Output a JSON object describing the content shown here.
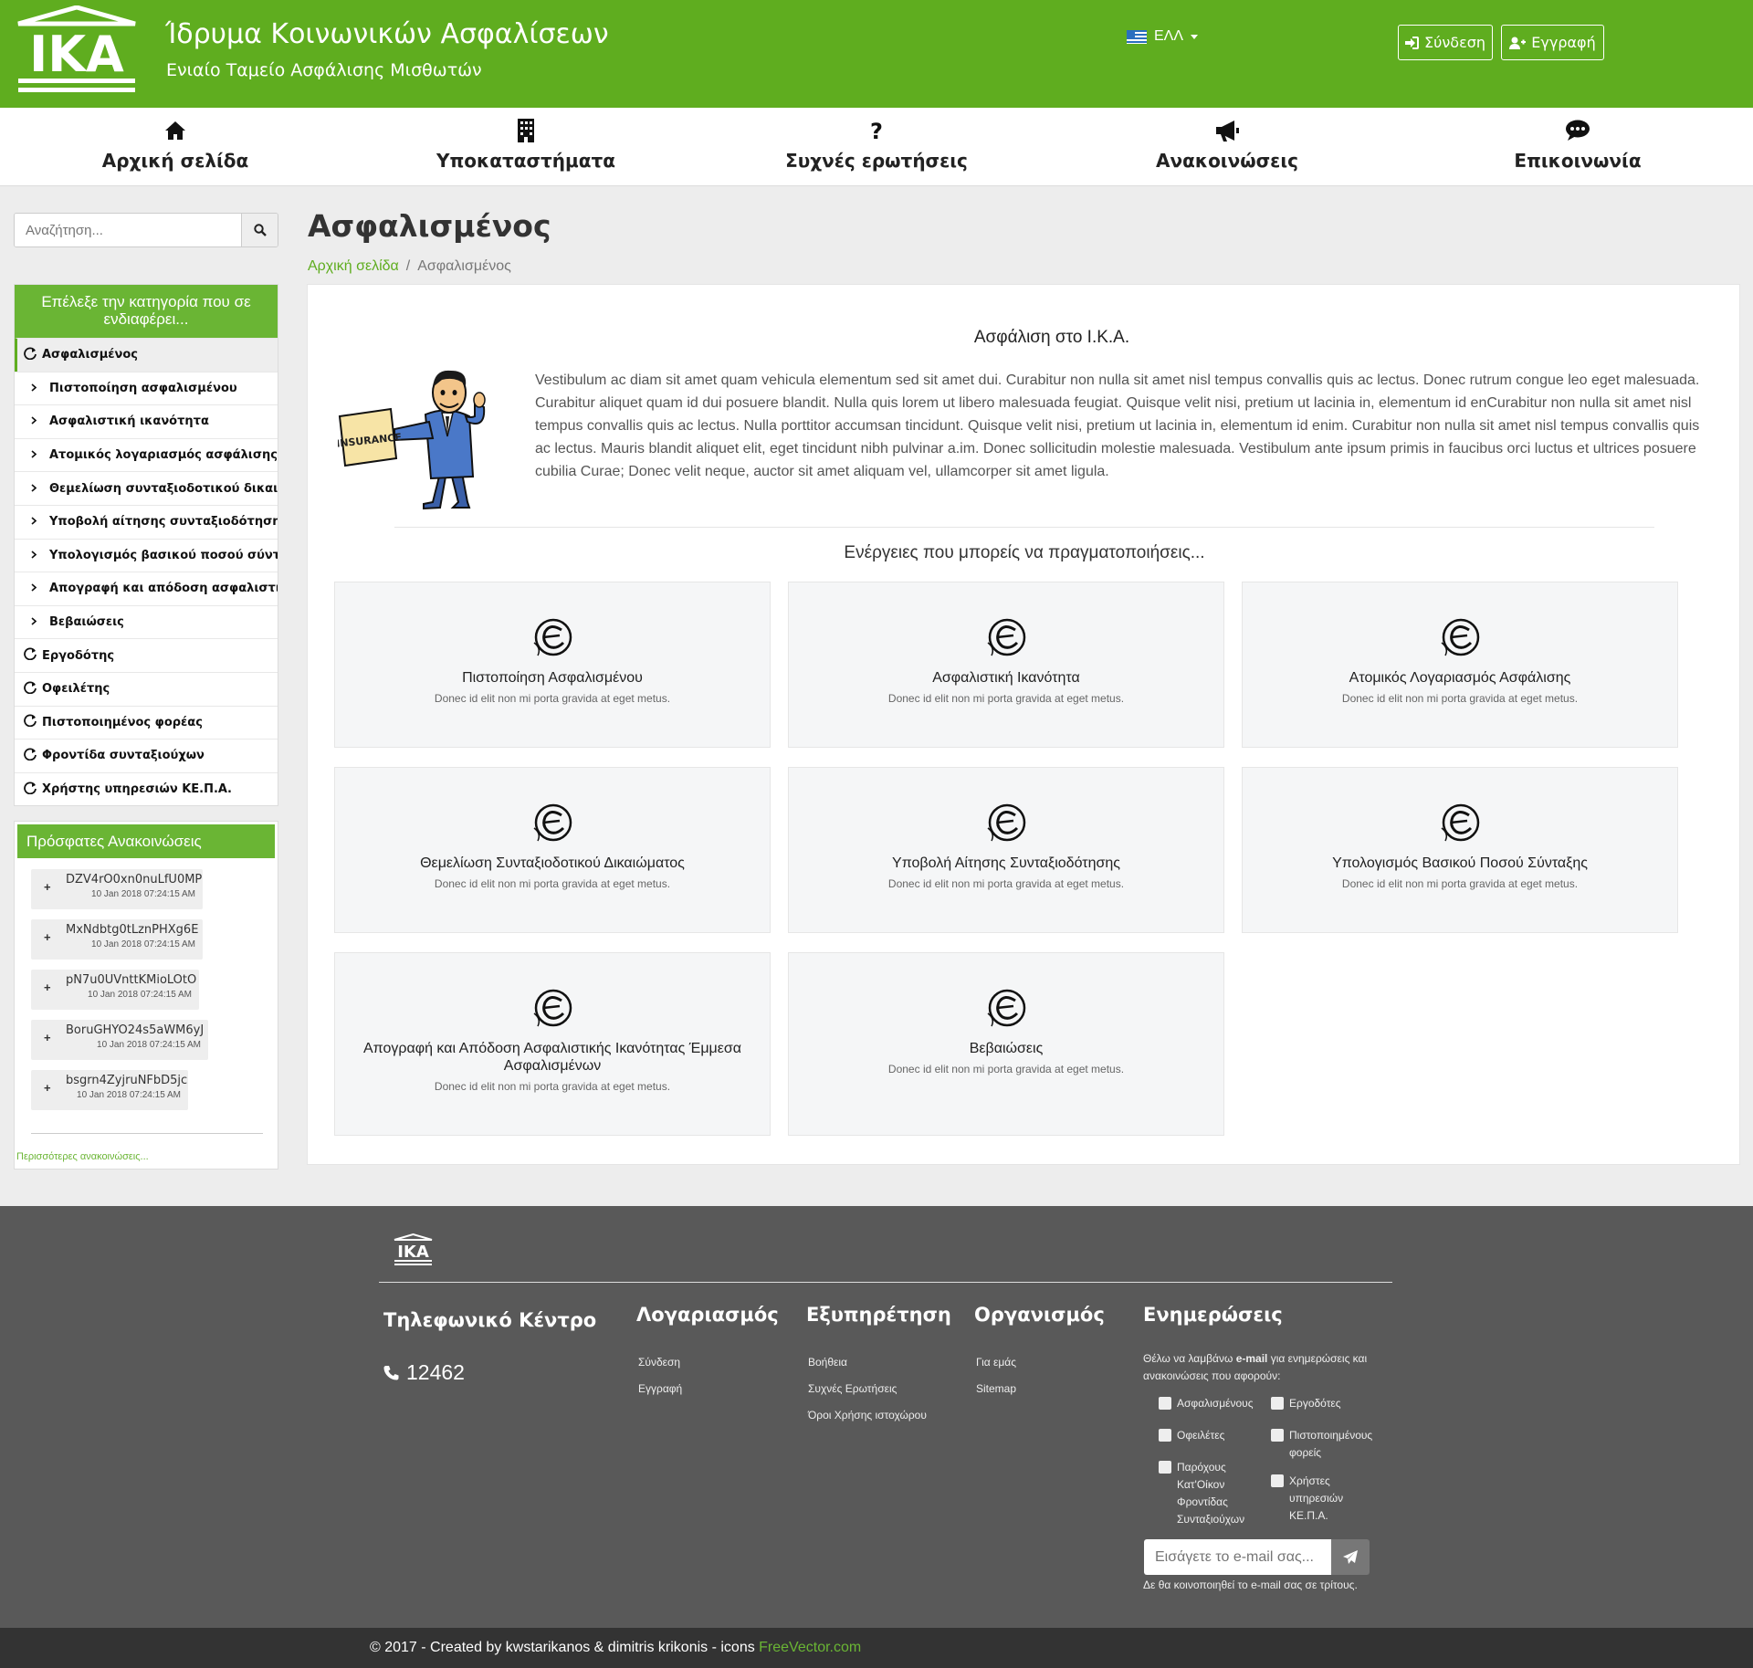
{
  "header": {
    "title": "Ίδρυμα Κοινωνικών Ασφαλίσεων",
    "subtitle": "Ενιαίο Ταμείο Ασφάλισης Μισθωτών",
    "logo_text": "IKA",
    "language": "ΕΛΛ",
    "login_label": "Σύνδεση",
    "register_label": "Εγγραφή"
  },
  "nav": [
    {
      "label": "Αρχική σελίδα",
      "icon": "home-icon"
    },
    {
      "label": "Υποκαταστήματα",
      "icon": "building-icon"
    },
    {
      "label": "Συχνές ερωτήσεις",
      "icon": "question-icon"
    },
    {
      "label": "Ανακοινώσεις",
      "icon": "bullhorn-icon"
    },
    {
      "label": "Επικοινωνία",
      "icon": "comment-icon"
    }
  ],
  "search": {
    "placeholder": "Αναζήτηση..."
  },
  "categories": {
    "heading": "Επέλεξε την κατηγορία που σε ενδιαφέρει...",
    "items": [
      {
        "label": "Ασφαλισμένος",
        "level": "top",
        "active": true
      },
      {
        "label": "Πιστοποίηση ασφαλισμένου",
        "level": "sub"
      },
      {
        "label": "Ασφαλιστική ικανότητα",
        "level": "sub"
      },
      {
        "label": "Ατομικός λογαριασμός ασφάλισης",
        "level": "sub"
      },
      {
        "label": "Θεμελίωση συνταξιοδοτικού δικαιώ...",
        "level": "sub"
      },
      {
        "label": "Υποβολή αίτησης συνταξιοδότησης",
        "level": "sub"
      },
      {
        "label": "Υπολογισμός βασικού ποσού σύντα...",
        "level": "sub"
      },
      {
        "label": "Απογραφή και απόδοση ασφαλιστικ...",
        "level": "sub"
      },
      {
        "label": "Βεβαιώσεις",
        "level": "sub"
      },
      {
        "label": "Εργοδότης",
        "level": "top"
      },
      {
        "label": "Οφειλέτης",
        "level": "top"
      },
      {
        "label": "Πιστοποιημένος φορέας",
        "level": "top"
      },
      {
        "label": "Φροντίδα συνταξιούχων",
        "level": "top"
      },
      {
        "label": "Χρήστης υπηρεσιών ΚΕ.Π.Α.",
        "level": "top"
      }
    ]
  },
  "announcements": {
    "heading": "Πρόσφατες Ανακοινώσεις",
    "items": [
      {
        "title": "DZV4rO0xn0nuLfU0MP",
        "date": "10 Jan 2018 07:24:15 AM"
      },
      {
        "title": "MxNdbtg0tLznPHXg6E",
        "date": "10 Jan 2018 07:24:15 AM"
      },
      {
        "title": "pN7u0UVnttKMioLOtO",
        "date": "10 Jan 2018 07:24:15 AM"
      },
      {
        "title": "BoruGHYO24s5aWM6yJ",
        "date": "10 Jan 2018 07:24:15 AM"
      },
      {
        "title": "bsgrn4ZyjruNFbD5jc",
        "date": "10 Jan 2018 07:24:15 AM"
      }
    ],
    "more": "Περισσότερες ανακοινώσεις..."
  },
  "main": {
    "title": "Ασφαλισμένος",
    "breadcrumb": [
      "Αρχική σελίδα",
      "/",
      "Ασφαλισμένος"
    ],
    "intro_title": "Ασφάλιση στο Ι.Κ.Α.",
    "mascot_text": "INSURANCE",
    "intro_text": "Vestibulum ac diam sit amet quam vehicula elementum sed sit amet dui. Curabitur non nulla sit amet nisl tempus convallis quis ac lectus. Donec rutrum congue leo eget malesuada. Curabitur aliquet quam id dui posuere blandit. Nulla quis lorem ut libero malesuada feugiat. Quisque velit nisi, pretium ut lacinia in, elementum id enCurabitur non nulla sit amet nisl tempus convallis quis ac lectus. Nulla porttitor accumsan tincidunt. Quisque velit nisi, pretium ut lacinia in, elementum id enim. Curabitur non nulla sit amet nisl tempus convallis quis ac lectus. Mauris blandit aliquet elit, eget tincidunt nibh pulvinar a.im. Donec sollicitudin molestie malesuada. Vestibulum ante ipsum primis in faucibus orci luctus et ultrices posuere cubilia Curae; Donec velit neque, auctor sit amet aliquam vel, ullamcorper sit amet ligula.",
    "actions_title": "Ενέργειες που μπορείς να πραγματοποιήσεις...",
    "actions": [
      {
        "title": "Πιστοποίηση Ασφαλισμένου",
        "desc": "Donec id elit non mi porta gravida at eget metus."
      },
      {
        "title": "Ασφαλιστική Ικανότητα",
        "desc": "Donec id elit non mi porta gravida at eget metus."
      },
      {
        "title": "Ατομικός Λογαριασμός Ασφάλισης",
        "desc": "Donec id elit non mi porta gravida at eget metus."
      },
      {
        "title": "Θεμελίωση Συνταξιοδοτικού Δικαιώματος",
        "desc": "Donec id elit non mi porta gravida at eget metus."
      },
      {
        "title": "Υποβολή Αίτησης Συνταξιοδότησης",
        "desc": "Donec id elit non mi porta gravida at eget metus."
      },
      {
        "title": "Υπολογισμός Βασικού Ποσού Σύνταξης",
        "desc": "Donec id elit non mi porta gravida at eget metus."
      },
      {
        "title": "Απογραφή και Απόδοση Ασφαλιστικής Ικανότητας Έμμεσα Ασφαλισμένων",
        "desc": "Donec id elit non mi porta gravida at eget metus."
      },
      {
        "title": "Βεβαιώσεις",
        "desc": "Donec id elit non mi porta gravida at eget metus."
      }
    ]
  },
  "footer": {
    "logo_text": "IKA",
    "phone_title": "Τηλεφωνικό Κέντρο",
    "phone": "12462",
    "columns": [
      {
        "title": "Λογαριασμός",
        "links": [
          "Σύνδεση",
          "Εγγραφή"
        ]
      },
      {
        "title": "Εξυπηρέτηση",
        "links": [
          "Βοήθεια",
          "Συχνές Ερωτήσεις",
          "Όροι Χρήσης ιστοχώρου"
        ]
      },
      {
        "title": "Οργανισμός",
        "links": [
          "Για εμάς",
          "Sitemap"
        ]
      }
    ],
    "newsletter": {
      "title": "Ενημερώσεις",
      "desc_pre": "Θέλω να λαμβάνω ",
      "desc_bold": "e-mail",
      "desc_post": " για ενημερώσεις και ανακοινώσεις που αφορούν:",
      "options_left": [
        "Ασφαλισμένους",
        "Οφειλέτες",
        "Παρόχους Κατ'Οίκον Φροντίδας Συνταξιούχων"
      ],
      "options_right": [
        "Εργοδότες",
        "Πιστοποιημένους φορείς",
        "Χρήστες υπηρεσιών ΚΕ.Π.Α."
      ],
      "placeholder": "Εισάγετε το e-mail σας...",
      "privacy": "Δε θα κοινοποιηθεί το e-mail σας σε τρίτους."
    },
    "copyright": "© 2017 - Created by kwstarikanos & dimitris krikonis - icons ",
    "copyright_link": "FreeVector.com"
  },
  "colors": {
    "brand_green": "#5fad1f",
    "sidebar_green": "#6ab534",
    "footer_bg": "#595959",
    "bottom_bar": "#333333"
  }
}
